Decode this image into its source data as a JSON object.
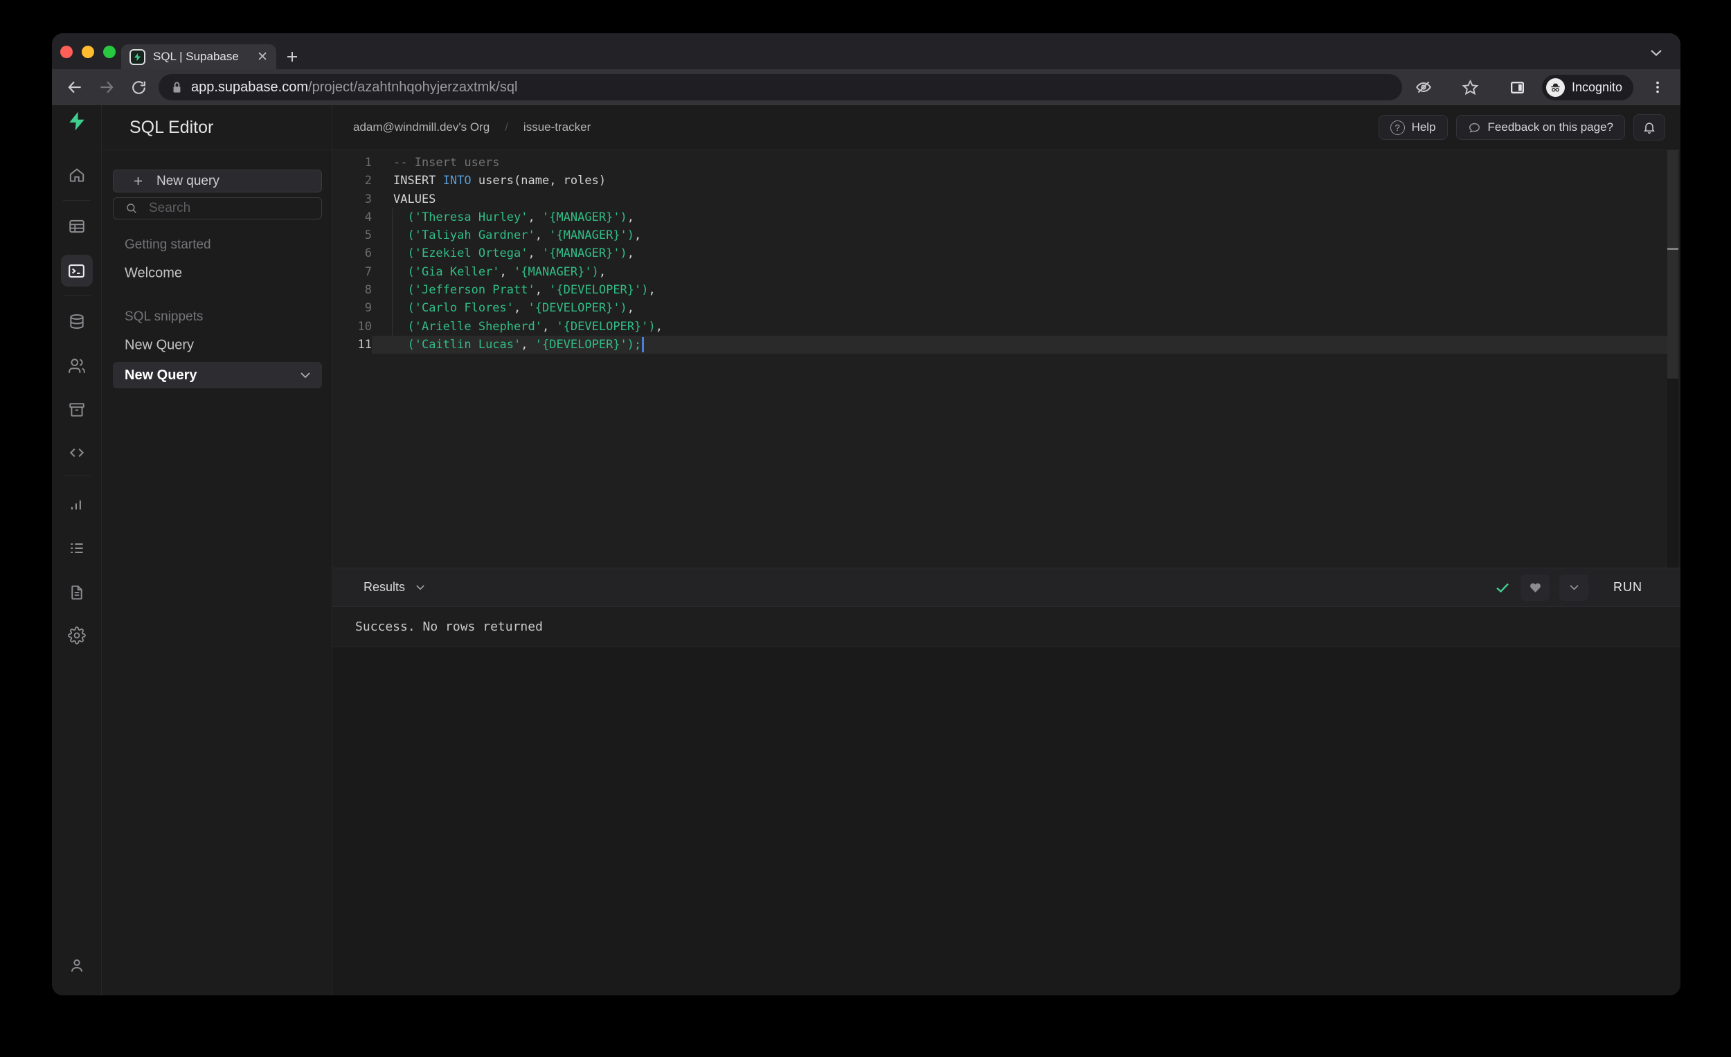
{
  "browser": {
    "tab_title": "SQL | Supabase",
    "url_domain": "app.supabase.com",
    "url_path": "/project/azahtnhqohyjerzaxtmk/sql",
    "incognito_label": "Incognito"
  },
  "app": {
    "sidebar_title": "SQL Editor",
    "new_query_button": "New query",
    "search_placeholder": "Search",
    "sections": [
      {
        "label": "Getting started",
        "items": [
          {
            "label": "Welcome"
          }
        ]
      },
      {
        "label": "SQL snippets",
        "items": [
          {
            "label": "New Query"
          },
          {
            "label": "New Query",
            "active": true
          }
        ]
      }
    ],
    "nav_icons": [
      "supabase-logo",
      "home",
      "table-editor",
      "sql-editor",
      "database",
      "authentication",
      "storage",
      "edge-functions",
      "reports",
      "logs",
      "api-docs",
      "settings",
      "account-user"
    ],
    "breadcrumb": {
      "org": "adam@windmill.dev's Org",
      "separator": "/",
      "project": "issue-tracker"
    },
    "header": {
      "help": "Help",
      "feedback": "Feedback on this page?"
    }
  },
  "editor": {
    "lines": [
      {
        "num": 1,
        "segments": [
          {
            "style": "comment",
            "text": "-- Insert users"
          }
        ]
      },
      {
        "num": 2,
        "segments": [
          {
            "style": "plain",
            "text": "INSERT "
          },
          {
            "style": "keyword",
            "text": "INTO"
          },
          {
            "style": "plain",
            "text": " users(name, roles)"
          }
        ]
      },
      {
        "num": 3,
        "segments": [
          {
            "style": "plain",
            "text": "VALUES"
          }
        ]
      },
      {
        "num": 4,
        "segments": [
          {
            "style": "plain",
            "text": "  "
          },
          {
            "style": "string",
            "text": "('Theresa Hurley'"
          },
          {
            "style": "plain",
            "text": ", "
          },
          {
            "style": "string",
            "text": "'{MANAGER}')"
          },
          {
            "style": "plain",
            "text": ","
          }
        ]
      },
      {
        "num": 5,
        "segments": [
          {
            "style": "plain",
            "text": "  "
          },
          {
            "style": "string",
            "text": "('Taliyah Gardner'"
          },
          {
            "style": "plain",
            "text": ", "
          },
          {
            "style": "string",
            "text": "'{MANAGER}')"
          },
          {
            "style": "plain",
            "text": ","
          }
        ]
      },
      {
        "num": 6,
        "segments": [
          {
            "style": "plain",
            "text": "  "
          },
          {
            "style": "string",
            "text": "('Ezekiel Ortega'"
          },
          {
            "style": "plain",
            "text": ", "
          },
          {
            "style": "string",
            "text": "'{MANAGER}')"
          },
          {
            "style": "plain",
            "text": ","
          }
        ]
      },
      {
        "num": 7,
        "segments": [
          {
            "style": "plain",
            "text": "  "
          },
          {
            "style": "string",
            "text": "('Gia Keller'"
          },
          {
            "style": "plain",
            "text": ", "
          },
          {
            "style": "string",
            "text": "'{MANAGER}')"
          },
          {
            "style": "plain",
            "text": ","
          }
        ]
      },
      {
        "num": 8,
        "segments": [
          {
            "style": "plain",
            "text": "  "
          },
          {
            "style": "string",
            "text": "('Jefferson Pratt'"
          },
          {
            "style": "plain",
            "text": ", "
          },
          {
            "style": "string",
            "text": "'{DEVELOPER}')"
          },
          {
            "style": "plain",
            "text": ","
          }
        ]
      },
      {
        "num": 9,
        "segments": [
          {
            "style": "plain",
            "text": "  "
          },
          {
            "style": "string",
            "text": "('Carlo Flores'"
          },
          {
            "style": "plain",
            "text": ", "
          },
          {
            "style": "string",
            "text": "'{DEVELOPER}')"
          },
          {
            "style": "plain",
            "text": ","
          }
        ]
      },
      {
        "num": 10,
        "segments": [
          {
            "style": "plain",
            "text": "  "
          },
          {
            "style": "string",
            "text": "('Arielle Shepherd'"
          },
          {
            "style": "plain",
            "text": ", "
          },
          {
            "style": "string",
            "text": "'{DEVELOPER}')"
          },
          {
            "style": "plain",
            "text": ","
          }
        ]
      },
      {
        "num": 11,
        "active": true,
        "cursor": true,
        "segments": [
          {
            "style": "plain",
            "text": "  "
          },
          {
            "style": "string",
            "text": "('Caitlin Lucas'"
          },
          {
            "style": "plain",
            "text": ", "
          },
          {
            "style": "string",
            "text": "'{DEVELOPER}');"
          }
        ]
      }
    ]
  },
  "results": {
    "label": "Results",
    "run": "RUN",
    "message": "Success. No rows returned"
  },
  "colors": {
    "accent_green": "#3ecf8e",
    "code_default": "#d4d4d4",
    "code_keyword": "#569cd6",
    "code_string": "#31bd86",
    "code_comment": "#737373",
    "cursor_blue": "#4c7fd9",
    "success_text": "#c9c9c9"
  }
}
